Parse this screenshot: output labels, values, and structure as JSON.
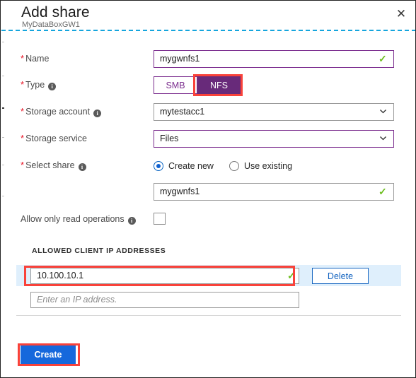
{
  "window": {
    "title": "Add share",
    "subtitle": "MyDataBoxGW1",
    "close_label": "✕"
  },
  "fields": {
    "name": {
      "label": "Name",
      "required": true,
      "value": "mygwnfs1",
      "state": "valid"
    },
    "type": {
      "label": "Type",
      "required": true,
      "has_info": true,
      "options": [
        "SMB",
        "NFS"
      ],
      "selected": "NFS"
    },
    "storage_account": {
      "label": "Storage account",
      "required": true,
      "has_info": true,
      "value": "mytestacc1"
    },
    "storage_service": {
      "label": "Storage service",
      "required": true,
      "value": "Files"
    },
    "select_share": {
      "label": "Select share",
      "required": true,
      "has_info": true,
      "options": [
        "Create new",
        "Use existing"
      ],
      "selected": "Create new",
      "share_name_value": "mygwnfs1"
    },
    "read_only": {
      "label": "Allow only read operations",
      "has_info": true,
      "checked": false
    }
  },
  "ip_section": {
    "title": "ALLOWED CLIENT IP ADDRESSES",
    "entries": [
      {
        "value": "10.100.10.1",
        "valid": true,
        "delete_label": "Delete"
      }
    ],
    "new_entry_placeholder": "Enter an IP address."
  },
  "actions": {
    "create_label": "Create"
  },
  "icons": {
    "check": "✓",
    "chevron_down": "∨",
    "info": "i"
  },
  "colors": {
    "accent_purple": "#682a7a",
    "border_purple": "#7b2d8e",
    "primary_blue": "#1668dc",
    "link_blue": "#1565c0",
    "valid_green": "#6ebe20",
    "required_red": "#e81123",
    "annotation_red": "#f9423a",
    "dashed_rule": "#15a5dd",
    "row_highlight": "#dfeffc"
  }
}
